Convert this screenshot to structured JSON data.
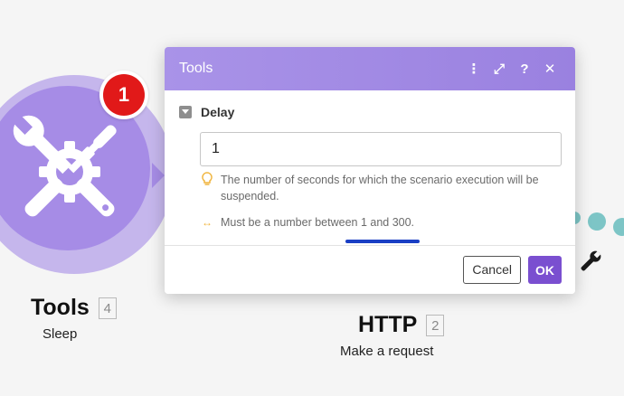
{
  "canvas": {
    "modules": [
      {
        "title": "Tools",
        "number": "4",
        "subtitle": "Sleep",
        "icon": "tools-icon",
        "badge": "1"
      },
      {
        "title": "HTTP",
        "number": "2",
        "subtitle": "Make a request"
      }
    ]
  },
  "dialog": {
    "title": "Tools",
    "header_buttons": [
      {
        "icon": "more-vertical-icon",
        "glyph": "⋮"
      },
      {
        "icon": "expand-icon",
        "glyph": "⤢"
      },
      {
        "icon": "help-icon",
        "glyph": "?"
      },
      {
        "icon": "close-icon",
        "glyph": "✕"
      }
    ],
    "field": {
      "label": "Delay",
      "value": "1",
      "hint_text": "The number of seconds for which the scenario execution will be suspended.",
      "hint_icon": "lightbulb-icon",
      "range_text": "Must be a number between 1 and 300.",
      "range_icon": "range-arrows-icon"
    },
    "footer": {
      "cancel_label": "Cancel",
      "ok_label": "OK"
    }
  },
  "colors": {
    "module_purple": "#a68ce6",
    "module_purple_light": "#c5b6ec",
    "badge_red": "#e11919",
    "header_purple": "#9a81e0",
    "ok_button": "#7a4fd0",
    "dot_teal": "#7dc5c6",
    "annotation_blue": "#1a3fc4"
  }
}
